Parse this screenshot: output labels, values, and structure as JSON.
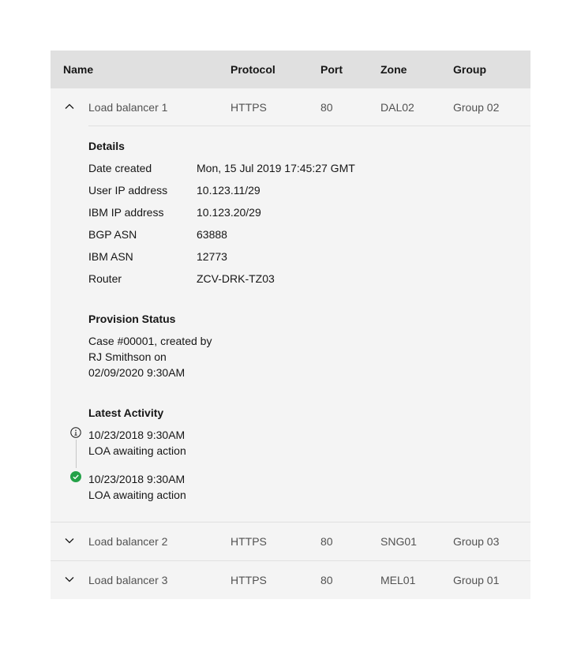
{
  "columns": {
    "name": "Name",
    "protocol": "Protocol",
    "port": "Port",
    "zone": "Zone",
    "group": "Group"
  },
  "rows": [
    {
      "name": "Load balancer 1",
      "protocol": "HTTPS",
      "port": "80",
      "zone": "DAL02",
      "group": "Group 02",
      "expanded": true
    },
    {
      "name": "Load balancer 2",
      "protocol": "HTTPS",
      "port": "80",
      "zone": "SNG01",
      "group": "Group 03",
      "expanded": false
    },
    {
      "name": "Load balancer 3",
      "protocol": "HTTPS",
      "port": "80",
      "zone": "MEL01",
      "group": "Group 01",
      "expanded": false
    }
  ],
  "details": {
    "title": "Details",
    "items": [
      {
        "label": "Date created",
        "value": "Mon, 15 Jul 2019 17:45:27 GMT"
      },
      {
        "label": "User IP address",
        "value": "10.123.11/29"
      },
      {
        "label": "IBM IP address",
        "value": "10.123.20/29"
      },
      {
        "label": "BGP ASN",
        "value": "63888"
      },
      {
        "label": "IBM ASN",
        "value": "12773"
      },
      {
        "label": "Router",
        "value": "ZCV-DRK-TZ03"
      }
    ]
  },
  "provision": {
    "title": "Provision Status",
    "lines": [
      "Case #00001, created by",
      "RJ Smithson on",
      "02/09/2020 9:30AM"
    ]
  },
  "activity": {
    "title": "Latest Activity",
    "events": [
      {
        "icon": "information-icon",
        "time": "10/23/2018 9:30AM",
        "text": "LOA awaiting action"
      },
      {
        "icon": "checkmark-filled-icon",
        "color": "#24a148",
        "time": "10/23/2018 9:30AM",
        "text": "LOA awaiting action"
      }
    ]
  }
}
